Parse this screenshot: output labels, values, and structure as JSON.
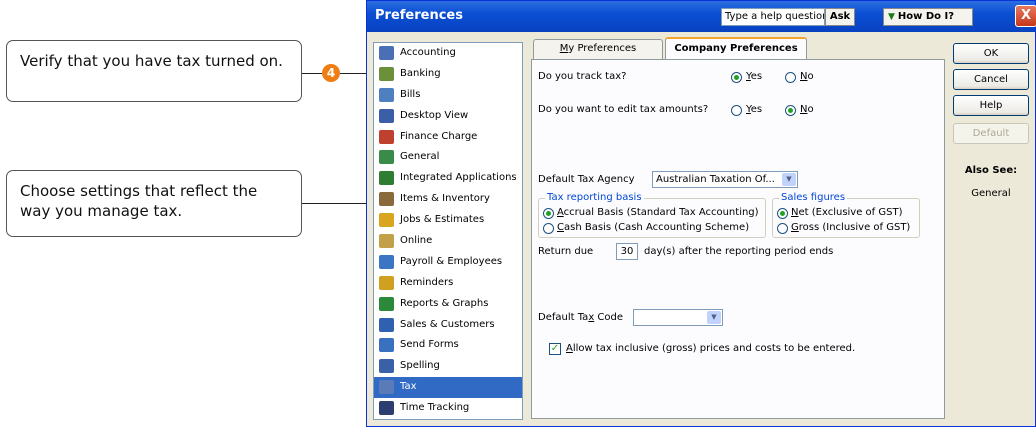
{
  "callouts": {
    "verify": "Verify that you have tax turned on.",
    "choose": "Choose settings that reflect the way you manage tax.",
    "step_number": "4"
  },
  "window": {
    "title": "Preferences",
    "help_placeholder": "Type a help question",
    "ask_label": "Ask",
    "how_do_i_label": "How Do I?",
    "close_glyph": "X"
  },
  "preference_list": [
    {
      "label": "Accounting",
      "icon": "accounting-icon",
      "color": "#4a6fb5"
    },
    {
      "label": "Banking",
      "icon": "banking-icon",
      "color": "#6c8f3a"
    },
    {
      "label": "Bills",
      "icon": "bills-icon",
      "color": "#4e7fbf"
    },
    {
      "label": "Desktop View",
      "icon": "desktop-view-icon",
      "color": "#3b5fa7"
    },
    {
      "label": "Finance Charge",
      "icon": "finance-charge-icon",
      "color": "#c04030"
    },
    {
      "label": "General",
      "icon": "general-icon",
      "color": "#3a8a4a"
    },
    {
      "label": "Integrated Applications",
      "icon": "integrated-applications-icon",
      "color": "#2e7d32"
    },
    {
      "label": "Items & Inventory",
      "icon": "items-inventory-icon",
      "color": "#8a6a3a"
    },
    {
      "label": "Jobs & Estimates",
      "icon": "jobs-estimates-icon",
      "color": "#d9a520"
    },
    {
      "label": "Online",
      "icon": "online-icon",
      "color": "#c2a04a"
    },
    {
      "label": "Payroll & Employees",
      "icon": "payroll-employees-icon",
      "color": "#3a76c4"
    },
    {
      "label": "Reminders",
      "icon": "reminders-icon",
      "color": "#d0a020"
    },
    {
      "label": "Reports & Graphs",
      "icon": "reports-graphs-icon",
      "color": "#2a8a3a"
    },
    {
      "label": "Sales & Customers",
      "icon": "sales-customers-icon",
      "color": "#3060b0"
    },
    {
      "label": "Send Forms",
      "icon": "send-forms-icon",
      "color": "#3a70c0"
    },
    {
      "label": "Spelling",
      "icon": "spelling-icon",
      "color": "#3a60a8"
    },
    {
      "label": "Tax",
      "icon": "tax-icon",
      "color": "#5a7ab8",
      "selected": true
    },
    {
      "label": "Time Tracking",
      "icon": "time-tracking-icon",
      "color": "#2c3e70"
    }
  ],
  "tabs": {
    "my_preferences": {
      "underlined": "M",
      "rest": "y Preferences"
    },
    "company_preferences": "Company Preferences"
  },
  "tax_form": {
    "track_tax_question": "Do you track tax?",
    "edit_amounts_question": "Do you want to edit tax amounts?",
    "yes_label": {
      "underlined": "Y",
      "rest": "es"
    },
    "no_label": {
      "underlined": "N",
      "rest": "o"
    },
    "track_tax_value": "Yes",
    "edit_amounts_value": "No",
    "default_agency_label": "Default Tax Agency",
    "default_agency_value": "Australian Taxation Of...",
    "reporting_basis_title": "Tax reporting basis",
    "accrual_label": {
      "underlined": "A",
      "rest": "ccrual Basis (Standard Tax Accounting)"
    },
    "cash_label": {
      "underlined": "C",
      "rest": "ash Basis (Cash Accounting Scheme)"
    },
    "reporting_basis_value": "Accrual",
    "sales_figures_title": "Sales figures",
    "net_label": {
      "underlined": "N",
      "rest": "et   (Exclusive of GST)"
    },
    "gross_label": {
      "underlined": "G",
      "rest": "ross (Inclusive of GST)"
    },
    "sales_figures_value": "Net",
    "return_due_label": "Return due",
    "return_due_days": "30",
    "return_due_suffix": "day(s) after the reporting period ends",
    "default_tax_code_label": {
      "before": "Default Ta",
      "underlined": "x",
      "after": " Code"
    },
    "default_tax_code_value": "",
    "allow_inclusive_label": {
      "underlined": "A",
      "rest": "llow tax inclusive (gross) prices and costs to be entered."
    },
    "allow_inclusive_checked": true
  },
  "side_buttons": {
    "ok": "OK",
    "cancel": "Cancel",
    "help": "Help",
    "default": "Default"
  },
  "also_see": {
    "title": "Also See:",
    "links": [
      "General"
    ]
  },
  "colors": {
    "titlebar": "#0b4fd4",
    "selection": "#316ac5",
    "radio_dot": "#21a121",
    "step_badge": "#f07d14"
  }
}
